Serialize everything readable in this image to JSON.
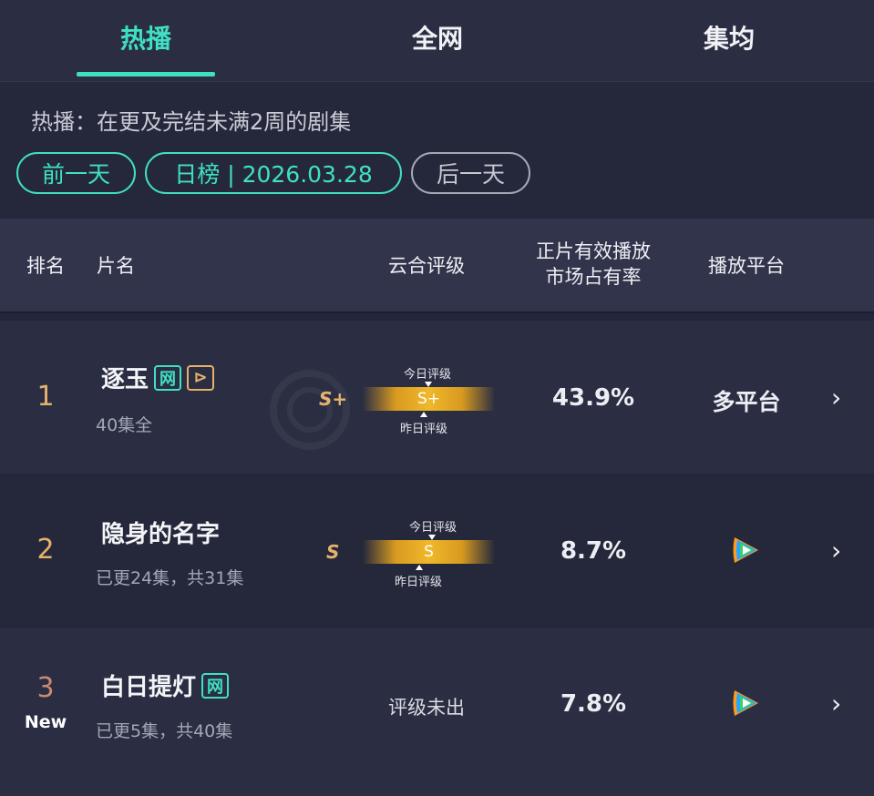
{
  "tabs": [
    {
      "label": "热播",
      "active": true
    },
    {
      "label": "全网",
      "active": false
    },
    {
      "label": "集均",
      "active": false
    }
  ],
  "description": "热播：在更及完结未满2周的剧集",
  "controls": {
    "prev_day": "前一天",
    "date_label": "日榜 | 2026.03.28",
    "next_day": "后一天"
  },
  "table_header": {
    "rank": "排名",
    "title": "片名",
    "rating": "云合评级",
    "share_line1": "正片有效播放",
    "share_line2": "市场占有率",
    "platform": "播放平台"
  },
  "rows": [
    {
      "rank": "1",
      "title": "逐玉",
      "badges": [
        "网",
        "⊳"
      ],
      "subtitle": "40集全",
      "rating_side": "S+",
      "rating_center": "S+",
      "today_label": "今日评级",
      "yesterday_label": "昨日评级",
      "share": "43.9%",
      "platform": "多平台"
    },
    {
      "rank": "2",
      "title": "隐身的名字",
      "subtitle": "已更24集，共31集",
      "rating_side": "S",
      "rating_center": "S",
      "today_label": "今日评级",
      "yesterday_label": "昨日评级",
      "share": "8.7%",
      "platform_icon": "tencent-video-icon"
    },
    {
      "rank": "3",
      "new_tag": "New",
      "title": "白日提灯",
      "badges": [
        "网"
      ],
      "subtitle": "已更5集，共40集",
      "rating_none": "评级未出",
      "share": "7.8%",
      "platform_icon": "tencent-video-icon"
    }
  ],
  "colors": {
    "accent": "#3fe0c4",
    "gold": "#e6b16a",
    "background": "#23263a"
  }
}
